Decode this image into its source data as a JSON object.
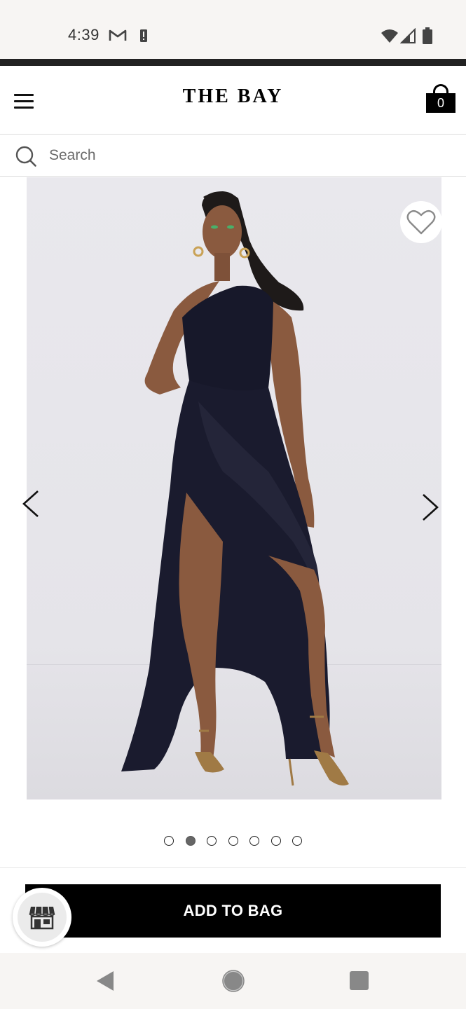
{
  "status_bar": {
    "time": "4:39",
    "icons": [
      "gmail-icon",
      "alert-icon",
      "wifi-icon",
      "signal-icon",
      "battery-icon"
    ]
  },
  "header": {
    "brand": "THE BAY",
    "bag_count": "0",
    "menu_icon": "hamburger-menu-icon",
    "bag_icon": "shopping-bag-icon"
  },
  "search": {
    "placeholder": "Search",
    "value": ""
  },
  "gallery": {
    "image_subject": "Model wearing a black one-shoulder satin maxi dress with high slit and gold strappy heels",
    "slide_count": 7,
    "active_slide": 2,
    "wishlist_icon": "heart-outline-icon",
    "prev_icon": "chevron-left-icon",
    "next_icon": "chevron-right-icon"
  },
  "cta": {
    "add_to_bag_label": "ADD TO BAG",
    "store_icon": "storefront-icon"
  },
  "colors": {
    "cta_background": "#000000",
    "cta_text": "#ffffff",
    "status_bar_background": "#f7f5f3",
    "divider": "#dcdcdc"
  },
  "nav_bar": {
    "icons": [
      "back-triangle-icon",
      "home-circle-icon",
      "recents-square-icon"
    ]
  }
}
